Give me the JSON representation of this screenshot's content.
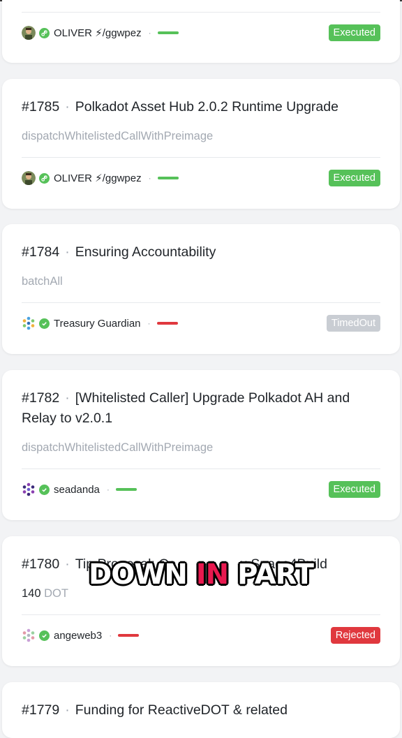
{
  "cards": [
    {
      "author": "OLIVER ⚡/ggwpez",
      "author_avatar_icon": "person-photo-icon",
      "verified_icon": "link-check-icon",
      "status": "Executed",
      "vote_color": "#56c159"
    },
    {
      "number": "#1785",
      "title": "Polkadot Asset Hub 2.0.2 Runtime Upgrade",
      "method": "dispatchWhitelistedCallWithPreimage",
      "author": "OLIVER ⚡/ggwpez",
      "author_avatar_icon": "person-photo-icon",
      "verified_icon": "link-check-icon",
      "status": "Executed",
      "vote_color": "#56c159"
    },
    {
      "number": "#1784",
      "title": "Ensuring Accountability",
      "method": "batchAll",
      "author": "Treasury Guardian",
      "author_avatar_icon": "polkadot-identicon-icon",
      "verified_icon": "check-circle-icon",
      "status": "TimedOut",
      "vote_color": "#e0383e"
    },
    {
      "number": "#1782",
      "title": "[Whitelisted Caller] Upgrade Polkadot AH and Relay to v2.0.1",
      "method": "dispatchWhitelistedCallWithPreimage",
      "author": "seadanda",
      "author_avatar_icon": "polkadot-identicon-icon",
      "verified_icon": "check-circle-icon",
      "status": "Executed",
      "vote_color": "#56c159"
    },
    {
      "number": "#1780",
      "title": "Tip Proposal: Co",
      "title_tail": "x Space4Build",
      "amount": "140",
      "amount_unit": "DOT",
      "author": "angeweb3",
      "author_avatar_icon": "polkadot-identicon-icon",
      "verified_icon": "check-circle-icon",
      "status": "Rejected",
      "vote_color": "#e0383e"
    },
    {
      "number": "#1779",
      "title": "Funding for ReactiveDOT & related"
    }
  ],
  "dot_separator": "·",
  "overlay_caption": {
    "word1": "DOWN",
    "word2": "IN",
    "word3": "PART",
    "highlight_color": "#e8194f"
  },
  "colors": {
    "executed": "#56c159",
    "rejected": "#e0383e",
    "timedout": "#c9cdd3",
    "muted_text": "#a3a9b2"
  }
}
